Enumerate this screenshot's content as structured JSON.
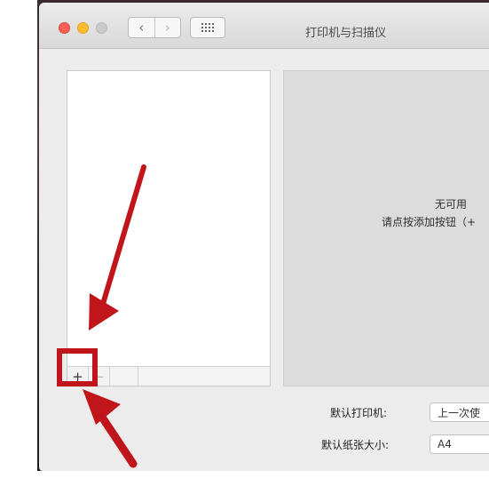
{
  "window": {
    "title": "打印机与扫描仪",
    "nav": {
      "back_glyph": "‹",
      "forward_glyph": "›"
    }
  },
  "printer_list": {
    "add_button_glyph": "+",
    "remove_button_glyph": "−"
  },
  "detail": {
    "empty_line1": "无可用",
    "empty_line2": "请点按添加按钮（+"
  },
  "settings": {
    "default_printer_label": "默认打印机:",
    "default_printer_value": "上一次使",
    "default_paper_label": "默认纸张大小:",
    "default_paper_value": "A4"
  },
  "icons": {
    "traffic_close": "close-icon",
    "traffic_minimize": "minimize-icon",
    "traffic_zoom": "zoom-icon",
    "show_all": "grid-icon",
    "annotation_arrows": "red-arrow-icon"
  },
  "colors": {
    "annotation": "#c0161b",
    "traffic_close": "#ff5f57",
    "traffic_minimize": "#febc2e",
    "detail_bg": "#dcdcdc"
  }
}
